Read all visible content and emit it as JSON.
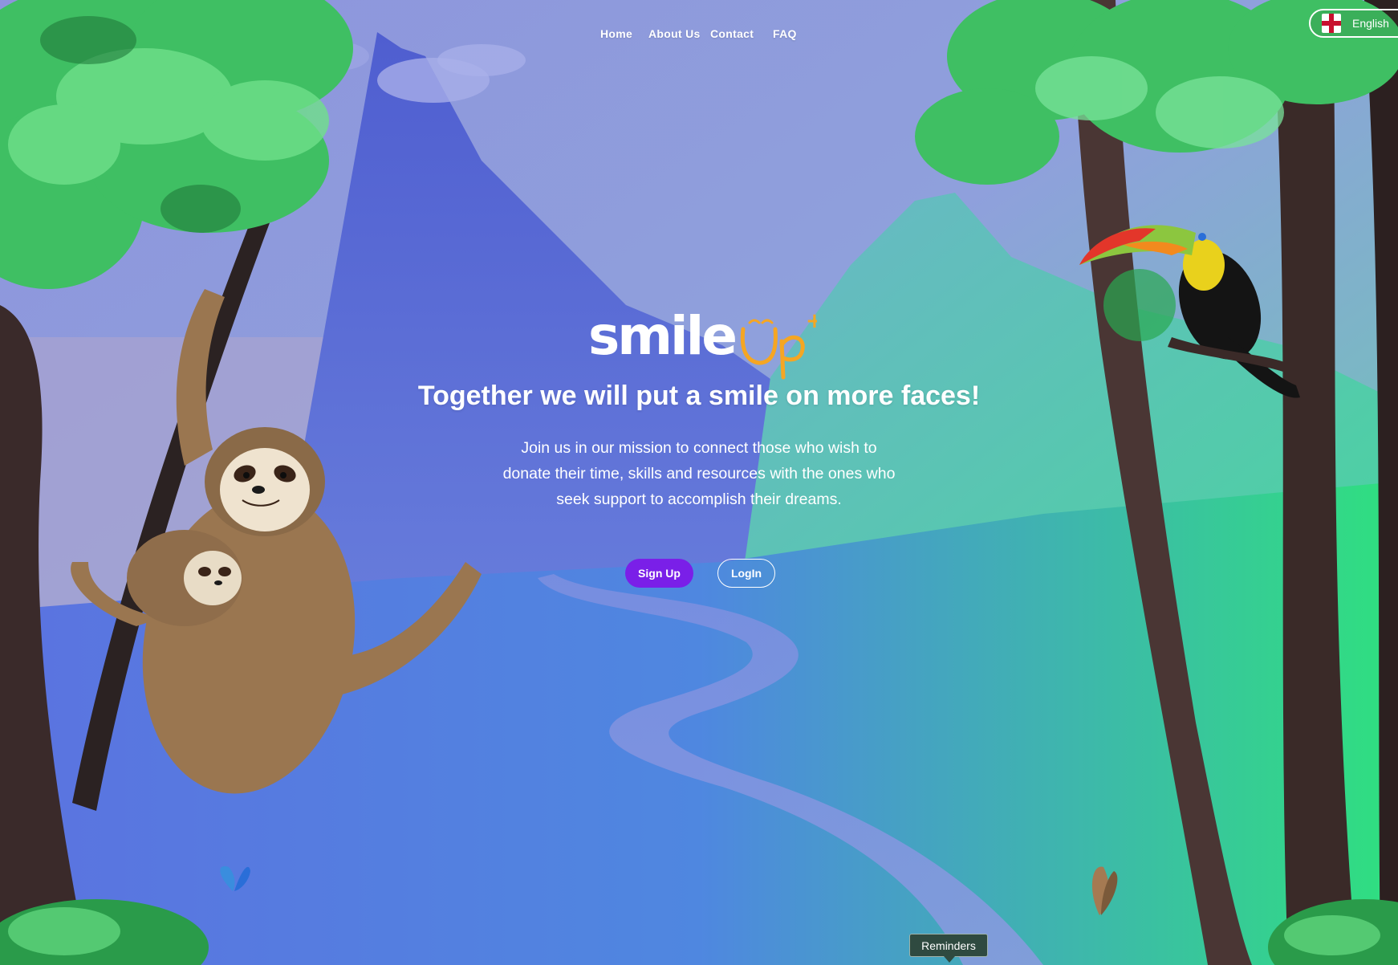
{
  "nav": {
    "items": [
      {
        "label": "Home"
      },
      {
        "label": "About Us"
      },
      {
        "label": "Contact"
      },
      {
        "label": "FAQ"
      }
    ]
  },
  "language": {
    "label": "English",
    "flag_icon": "england-flag-icon"
  },
  "brand": {
    "logo_text": "smile",
    "logo_suffix": "up",
    "logo_plus": "+",
    "accent": "#f5a623"
  },
  "hero": {
    "headline": "Together we will put a smile on more faces!",
    "subtext": "Join us in our mission to connect those who wish to donate their time, skills and resources with the ones who seek support to accomplish their dreams."
  },
  "actions": {
    "signup_label": "Sign Up",
    "login_label": "LogIn",
    "signup_color": "#7a1fe8"
  },
  "tooltip": {
    "label": "Reminders"
  },
  "illustration": {
    "icons": [
      "sloth-illustration",
      "toucan-illustration",
      "butterfly-icon",
      "mountain-illustration",
      "tree-illustration"
    ]
  }
}
